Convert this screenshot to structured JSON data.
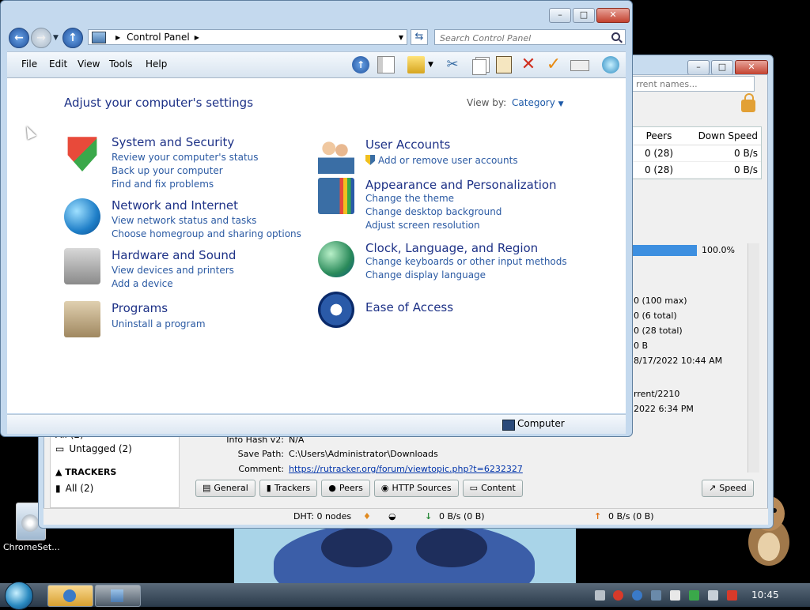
{
  "control_panel": {
    "address": {
      "breadcrumb": "Control Panel",
      "search_placeholder": "Search Control Panel"
    },
    "menu": {
      "file": "File",
      "edit": "Edit",
      "view": "View",
      "tools": "Tools",
      "help": "Help"
    },
    "heading": "Adjust your computer's settings",
    "view_by_label": "View by:",
    "view_by_value": "Category",
    "categories": [
      {
        "title": "System and Security",
        "links": [
          "Review your computer's status",
          "Back up your computer",
          "Find and fix problems"
        ],
        "icon": "shield-icon"
      },
      {
        "title": "Network and Internet",
        "links": [
          "View network status and tasks",
          "Choose homegroup and sharing options"
        ],
        "icon": "network-globe-icon"
      },
      {
        "title": "Hardware and Sound",
        "links": [
          "View devices and printers",
          "Add a device"
        ],
        "icon": "printer-icon"
      },
      {
        "title": "Programs",
        "links": [
          "Uninstall a program"
        ],
        "icon": "programs-icon"
      },
      {
        "title": "User Accounts",
        "links": [
          "Add or remove user accounts"
        ],
        "icon": "users-icon"
      },
      {
        "title": "Appearance and Personalization",
        "links": [
          "Change the theme",
          "Change desktop background",
          "Adjust screen resolution"
        ],
        "icon": "appearance-icon"
      },
      {
        "title": "Clock, Language, and Region",
        "links": [
          "Change keyboards or other input methods",
          "Change display language"
        ],
        "icon": "clock-globe-icon"
      },
      {
        "title": "Ease of Access",
        "links": [],
        "icon": "ease-of-access-icon"
      }
    ],
    "status": "Computer"
  },
  "qbittorrent": {
    "search_placeholder": "rrent names...",
    "table": {
      "headers": [
        "Peers",
        "Down Speed"
      ],
      "rows": [
        [
          "0 (28)",
          "0 B/s"
        ],
        [
          "0 (28)",
          "0 B/s"
        ]
      ]
    },
    "progress_text": "100.0%",
    "progress": 1.0,
    "info_lines": [
      "0 (100 max)",
      "0 (6 total)",
      "0 (28 total)",
      "0 B",
      "8/17/2022 10:44 AM"
    ],
    "info_lines2": [
      "rrent/2210",
      "2022 6:34 PM"
    ],
    "sidebar": {
      "all_partial": "All (2)",
      "untagged": "Untagged (2)",
      "trackers_header": "TRACKERS",
      "trackers_all": "All (2)"
    },
    "details": {
      "info_hash_label": "Info Hash v2:",
      "info_hash_value": "N/A",
      "save_path_label": "Save Path:",
      "save_path_value": "C:\\Users\\Administrator\\Downloads",
      "comment_label": "Comment:",
      "comment_value": "https://rutracker.org/forum/viewtopic.php?t=6232327"
    },
    "tabs": [
      "General",
      "Trackers",
      "Peers",
      "HTTP Sources",
      "Content"
    ],
    "speed_tab": "Speed",
    "statusbar": {
      "dht": "DHT: 0 nodes",
      "down": "0 B/s (0 B)",
      "up": "0 B/s (0 B)"
    }
  },
  "desktop": {
    "icon_label": "ChromeSet..."
  },
  "taskbar": {
    "clock": "10:45"
  },
  "colors": {
    "link": "#2b5aa3",
    "heading": "#1e3287",
    "progress": "#3d8fe0"
  }
}
